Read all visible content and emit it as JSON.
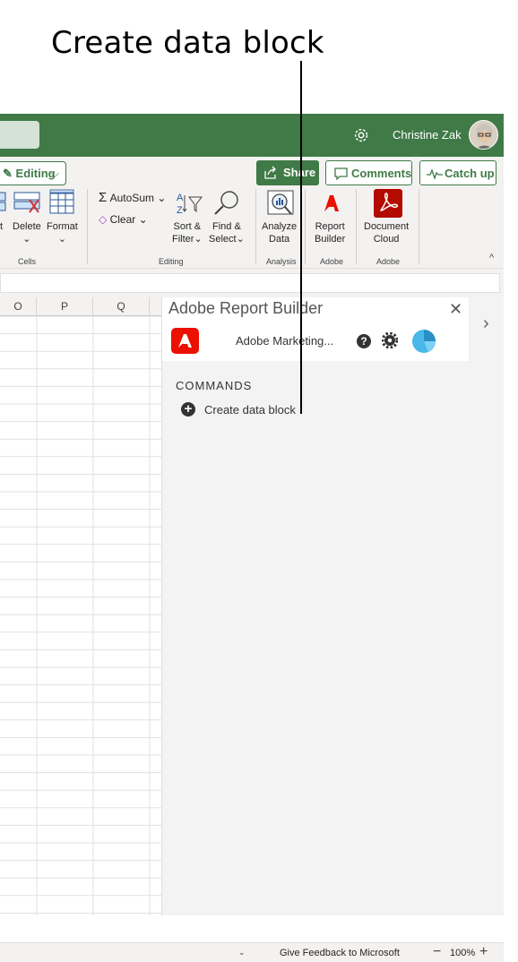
{
  "annotation": {
    "title": "Create data block"
  },
  "titlebar": {
    "user_name": "Christine Zak"
  },
  "ribbon": {
    "editing_label": "Editing",
    "share_label": "Share",
    "comments_label": "Comments",
    "catchup_label": "Catch up",
    "cells": {
      "insert_label_fragment": "t",
      "delete_label": "Delete",
      "format_label": "Format",
      "group_label": "Cells"
    },
    "editing_group": {
      "autosum_label": "AutoSum",
      "clear_label": "Clear",
      "sort_label_1": "Sort &",
      "sort_label_2": "Filter",
      "find_label_1": "Find &",
      "find_label_2": "Select",
      "group_label": "Editing"
    },
    "analysis": {
      "analyze_label_1": "Analyze",
      "analyze_label_2": "Data",
      "group_label": "Analysis"
    },
    "adobe1": {
      "report_label_1": "Report",
      "report_label_2": "Builder",
      "group_label": "Adobe"
    },
    "adobe2": {
      "doc_label_1": "Document",
      "doc_label_2": "Cloud",
      "group_label": "Adobe"
    }
  },
  "grid": {
    "columns": [
      "O",
      "P",
      "Q"
    ]
  },
  "panel": {
    "title": "Adobe Report Builder",
    "org_name": "Adobe Marketing...",
    "help_glyph": "?",
    "commands_label": "COMMANDS",
    "commands": [
      {
        "label": "Create data block"
      }
    ]
  },
  "statusbar": {
    "feedback": "Give Feedback to Microsoft",
    "zoom": "100%"
  },
  "colors": {
    "excel_green": "#3f7a47",
    "adobe_red": "#eb1000",
    "acrobat_red": "#b30b00"
  }
}
